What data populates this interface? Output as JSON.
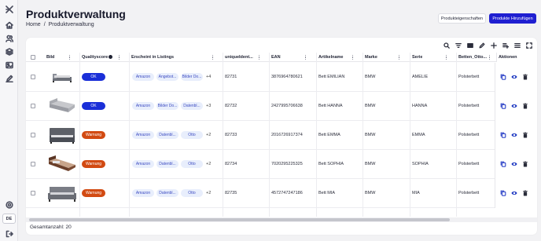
{
  "page": {
    "title": "Produktverwaltung",
    "breadcrumb": [
      "Home",
      "/",
      "Produktverwaltung"
    ]
  },
  "buttons": {
    "properties": "Produkteigenschaften",
    "add": "Produkte Hinzufügen"
  },
  "sidebar": {
    "items": [
      "logo-icon",
      "home-icon",
      "users-icon",
      "layers-icon",
      "image-icon",
      "pen-icon"
    ],
    "bottom": [
      "settings-icon",
      "logout-icon"
    ],
    "language": "DE"
  },
  "colors": {
    "primary": "#1f1fd1",
    "ok": "#1a2fd8",
    "warning": "#d24a12",
    "chip_bg": "#e8eefc",
    "chip_text": "#3d4cc2",
    "copy": "#2f45c8",
    "view": "#1a35c0"
  },
  "table": {
    "columns": [
      "Bild",
      "Qualityscore",
      "Erscheint in Listings",
      "uniqueIdent...",
      "EAN",
      "Artikelname",
      "Marke",
      "Serie",
      "Betten_Otto...",
      "Aktionen"
    ],
    "rows": [
      {
        "image": "bed-low",
        "quality": "OK",
        "quality_level": "ok",
        "listings": [
          "Amazon",
          "Angebot...",
          "Bilder Do..."
        ],
        "more": "+4",
        "unique_id": "82731",
        "ean": "3876964780621",
        "name": "Bett EMILIAN",
        "brand": "BMW",
        "series": "AMELIE",
        "betten_otto": "Polsterbett"
      },
      {
        "image": "bed-upholstered",
        "quality": "OK",
        "quality_level": "ok",
        "listings": [
          "Amazon",
          "Bilder Do...",
          "Datenbl..."
        ],
        "more": "+3",
        "unique_id": "82732",
        "ean": "2427995706638",
        "name": "Bett HANNA",
        "brand": "BMW",
        "series": "HANNA",
        "betten_otto": "Polsterbett"
      },
      {
        "image": "bed-grey",
        "quality": "Warnung",
        "quality_level": "warning",
        "listings": [
          "Amazon",
          "Datenbl...",
          "Otto"
        ],
        "more": "+2",
        "unique_id": "82733",
        "ean": "2016726917374",
        "name": "Bett EMMA",
        "brand": "BMW",
        "series": "EMMA",
        "betten_otto": "Polsterbett"
      },
      {
        "image": "bed-wood",
        "quality": "Warnung",
        "quality_level": "warning",
        "listings": [
          "Amazon",
          "Datenbl...",
          "Otto"
        ],
        "more": "+2",
        "unique_id": "82734",
        "ean": "7020295225325",
        "name": "Bett SOPHIA",
        "brand": "BMW",
        "series": "SOPHIA",
        "betten_otto": "Polsterbett"
      },
      {
        "image": "bed-grey-frame",
        "quality": "Warnung",
        "quality_level": "warning",
        "listings": [
          "Amazon",
          "Datenbl...",
          "Otto"
        ],
        "more": "+2",
        "unique_id": "82735",
        "ean": "4572747247186",
        "name": "Bett MIA",
        "brand": "BMW",
        "series": "MIA",
        "betten_otto": "Polsterbett"
      }
    ],
    "total_label": "Gesamtanzahl: 20"
  }
}
